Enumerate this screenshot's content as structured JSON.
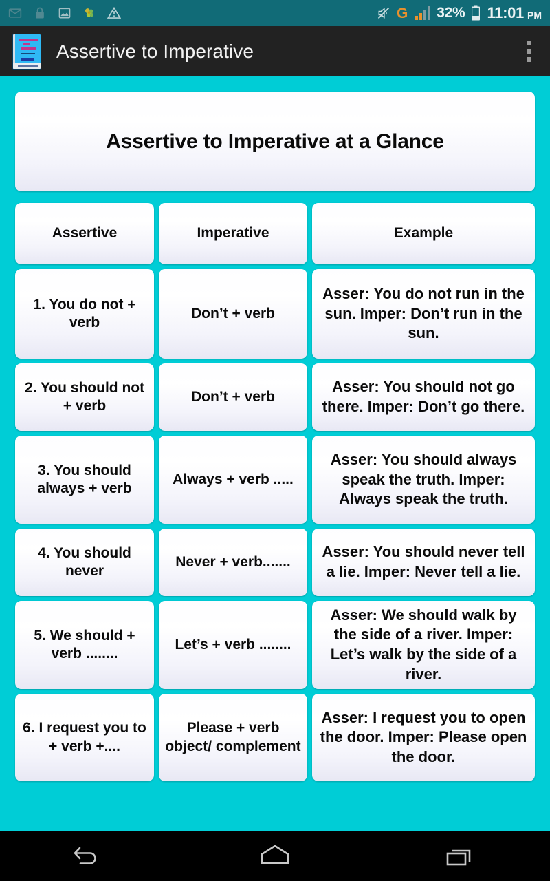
{
  "status_bar": {
    "background": "#116b77",
    "left_icons": [
      "mail-icon",
      "lock-icon",
      "image-icon",
      "flower-icon",
      "warning-icon"
    ],
    "mute_icon": "mute-icon",
    "network_type": "G",
    "network_color": "#e8912d",
    "signal_icon": "signal-bars-icon",
    "battery_percent": "32%",
    "battery_icon": "battery-icon",
    "time": "11:01",
    "am_pm": "PM"
  },
  "app_bar": {
    "background": "#222222",
    "icon_name": "book-app-icon",
    "title": "Assertive to Imperative",
    "overflow_label": "overflow-menu"
  },
  "page": {
    "background": "#00cdd6",
    "heading": "Assertive to Imperative at a Glance"
  },
  "table": {
    "headers": [
      "Assertive",
      "Imperative",
      "Example"
    ],
    "rows": [
      {
        "assertive": "1. You do not  + verb",
        "imperative": "Don’t + verb",
        "example": "Asser:  You do not  run in the sun.\nImper:  Don’t   run in  the sun."
      },
      {
        "assertive": "2. You should not  + verb",
        "imperative": "Don’t + verb",
        "example": "Asser:  You should   not  go there.\nImper:  Don’t  go  there."
      },
      {
        "assertive": "3. You should always + verb",
        "imperative": "Always + verb .....",
        "example": "Asser: You should  always speak the truth.\nImper:  Always  speak the truth."
      },
      {
        "assertive": "4. You should never",
        "imperative": "Never + verb.......",
        "example": "Asser: You should   never tell a lie.\nImper:  Never tell a lie."
      },
      {
        "assertive": "5. We should + verb ........",
        "imperative": "Let’s + verb ........",
        "example": "Asser: We should walk by the side of a river.\nImper: Let’s  walk by the side of a river."
      },
      {
        "assertive": "6. I request you to  + verb +....",
        "imperative": "Please + verb object/ complement",
        "example": "Asser:  I request  you to open the door.\nImper: Please open the door."
      }
    ]
  },
  "nav_bar": {
    "background": "#000000",
    "buttons": [
      "back-button",
      "home-button",
      "recents-button"
    ]
  }
}
